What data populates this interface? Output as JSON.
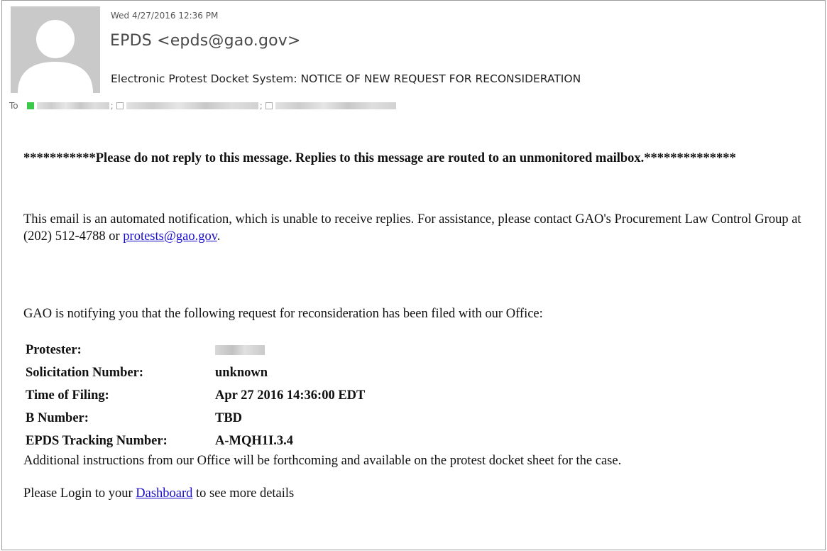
{
  "header": {
    "date": "Wed 4/27/2016 12:36 PM",
    "from": "EPDS <epds@gao.gov>",
    "subject": "Electronic Protest Docket System:  NOTICE OF NEW REQUEST FOR RECONSIDERATION",
    "to_label": "To"
  },
  "body": {
    "warning": "***********Please do not reply to this message. Replies to this message are routed to an unmonitored mailbox.**************",
    "intro_text": "This email is an automated notification, which is unable to receive replies. For assistance, please contact GAO's Procurement Law Control Group at (202) 512-4788 or ",
    "intro_link": "protests@gao.gov",
    "intro_end": ".",
    "notify": "GAO is notifying you that the following request for reconsideration has been filed with our Office:",
    "details": [
      {
        "label": "Protester:",
        "value": ""
      },
      {
        "label": "Solicitation Number:",
        "value": "unknown"
      },
      {
        "label": "Time of Filing:",
        "value": "Apr 27 2016 14:36:00 EDT"
      },
      {
        "label": "B Number:",
        "value": "TBD"
      },
      {
        "label": "EPDS Tracking Number:",
        "value": "A-MQH1I.3.4"
      }
    ],
    "additional": "Additional instructions from our Office will be forthcoming and available on the protest docket sheet for the case.",
    "login_prefix": "Please Login to your ",
    "login_link": "Dashboard",
    "login_suffix": " to see more details"
  },
  "colors": {
    "link": "#1a0dcc",
    "presence": "#3cc84a",
    "avatar_bg": "#c9c9c9"
  },
  "icons": {
    "avatar": "person-silhouette-icon",
    "presence": "presence-status-icon"
  }
}
